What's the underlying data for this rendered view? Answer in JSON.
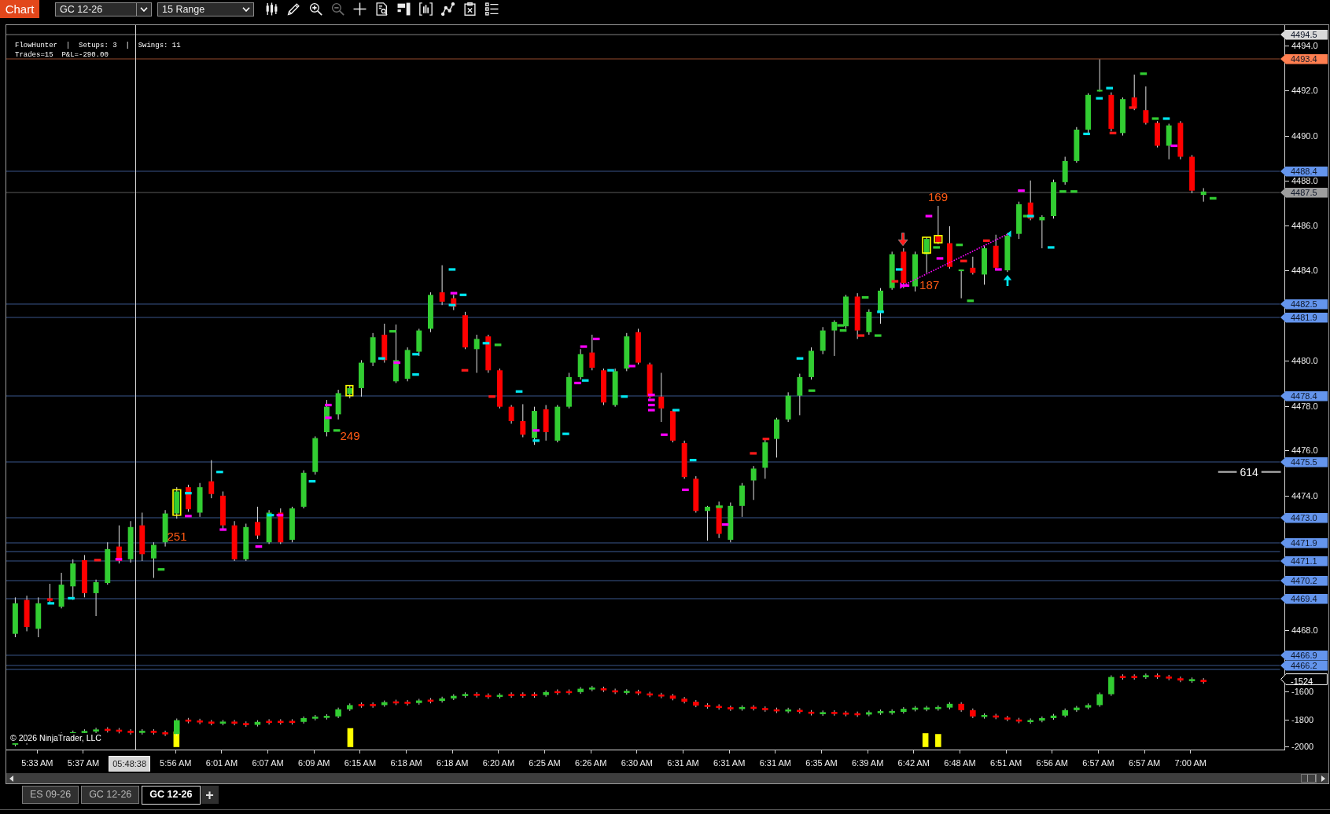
{
  "toolbar": {
    "title": "Chart",
    "instrument": "GC 12-26",
    "bar_type": "15 Range",
    "buttons": [
      {
        "kind": "candles",
        "disabled": false
      },
      {
        "kind": "pencil",
        "disabled": false
      },
      {
        "kind": "zoomin",
        "disabled": false
      },
      {
        "kind": "zoomout",
        "disabled": true
      },
      {
        "kind": "crosshair",
        "disabled": false
      },
      {
        "kind": "docsearch",
        "disabled": false
      },
      {
        "kind": "panels",
        "disabled": false
      },
      {
        "kind": "framedbars",
        "disabled": false
      },
      {
        "kind": "nodes",
        "disabled": false
      },
      {
        "kind": "clipboard",
        "disabled": false
      },
      {
        "kind": "list",
        "disabled": false
      }
    ]
  },
  "strategy_info": {
    "status_line": "FlowHunter  |  Setups: 3  |  Swings: 11",
    "trades_line": "Trades=15  P&L=-290.00"
  },
  "price_chart": {
    "annotations": [
      "169",
      "187",
      "249",
      "251"
    ],
    "ruler_value": "614",
    "price_ticks": [
      "4494.0",
      "4492.0",
      "4490.0",
      "4488.0",
      "4486.0",
      "4484.0",
      "4480.0",
      "4478.0",
      "4476.0",
      "4474.0",
      "4468.0"
    ],
    "price_levels": [
      {
        "label": "4494.5",
        "color": "#d9d9d9"
      },
      {
        "label": "4493.4",
        "color": "#ff7f50"
      },
      {
        "label": "4488.4",
        "color": "#6495ed"
      },
      {
        "label": "4487.5",
        "color": "#9e9e9e"
      },
      {
        "label": "4482.5",
        "color": "#6495ed"
      },
      {
        "label": "4481.9",
        "color": "#6495ed"
      },
      {
        "label": "4478.4",
        "color": "#6495ed"
      },
      {
        "label": "4475.5",
        "color": "#6495ed"
      },
      {
        "label": "4473.0",
        "color": "#6495ed"
      },
      {
        "label": "4471.9",
        "color": "#6495ed"
      },
      {
        "label": "4471.1",
        "color": "#6495ed"
      },
      {
        "label": "4470.2",
        "color": "#6495ed"
      },
      {
        "label": "4469.4",
        "color": "#6495ed"
      },
      {
        "label": "4466.9",
        "color": "#6495ed"
      },
      {
        "label": "4466.2",
        "color": "#6495ed"
      }
    ]
  },
  "indicator_panel": {
    "current_value": "-1524",
    "ticks": [
      "-1600",
      "-1800",
      "-2000"
    ],
    "copyright": "© 2026 NinjaTrader, LLC"
  },
  "time_axis": [
    {
      "label": "5:33 AM",
      "kind": "tick"
    },
    {
      "label": "5:37 AM",
      "kind": "tick"
    },
    {
      "label": "05:48:38",
      "kind": "cursor"
    },
    {
      "label": "5:56 AM",
      "kind": "tick"
    },
    {
      "label": "6:01 AM",
      "kind": "tick"
    },
    {
      "label": "6:07 AM",
      "kind": "tick"
    },
    {
      "label": "6:09 AM",
      "kind": "tick"
    },
    {
      "label": "6:15 AM",
      "kind": "tick"
    },
    {
      "label": "6:18 AM",
      "kind": "tick"
    },
    {
      "label": "6:18 AM",
      "kind": "tick"
    },
    {
      "label": "6:20 AM",
      "kind": "tick"
    },
    {
      "label": "6:25 AM",
      "kind": "tick"
    },
    {
      "label": "6:26 AM",
      "kind": "tick"
    },
    {
      "label": "6:30 AM",
      "kind": "tick"
    },
    {
      "label": "6:31 AM",
      "kind": "tick"
    },
    {
      "label": "6:31 AM",
      "kind": "tick"
    },
    {
      "label": "6:31 AM",
      "kind": "tick"
    },
    {
      "label": "6:35 AM",
      "kind": "tick"
    },
    {
      "label": "6:39 AM",
      "kind": "tick"
    },
    {
      "label": "6:42 AM",
      "kind": "tick"
    },
    {
      "label": "6:48 AM",
      "kind": "tick"
    },
    {
      "label": "6:51 AM",
      "kind": "tick"
    },
    {
      "label": "6:56 AM",
      "kind": "tick"
    },
    {
      "label": "6:57 AM",
      "kind": "tick"
    },
    {
      "label": "6:57 AM",
      "kind": "tick"
    },
    {
      "label": "7:00 AM",
      "kind": "tick"
    }
  ],
  "tabs": [
    {
      "label": "ES 09-26",
      "selected": false
    },
    {
      "label": "GC 12-26",
      "selected": false
    },
    {
      "label": "GC 12-26",
      "selected": true
    }
  ],
  "add_tab": "+"
}
